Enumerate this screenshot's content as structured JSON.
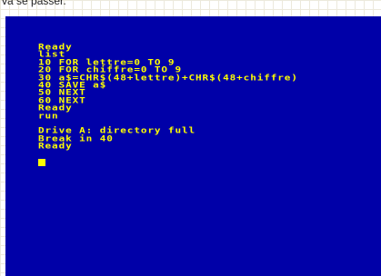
{
  "caption": "va se passer.",
  "terminal": {
    "lines": [
      "Ready",
      "list",
      "10 FOR lettre=0 TO 9",
      "20 FOR chiffre=0 TO 9",
      "30 a$=CHR$(48+lettre)+CHR$(48+chiffre)",
      "40 SAVE a$",
      "50 NEXT",
      "60 NEXT",
      "Ready",
      "run",
      "",
      "Drive A: directory full",
      "Break in 40",
      "Ready"
    ]
  },
  "colors": {
    "screen_background": "#0000a8",
    "text": "#ffff00",
    "cursor": "#ffff00"
  }
}
